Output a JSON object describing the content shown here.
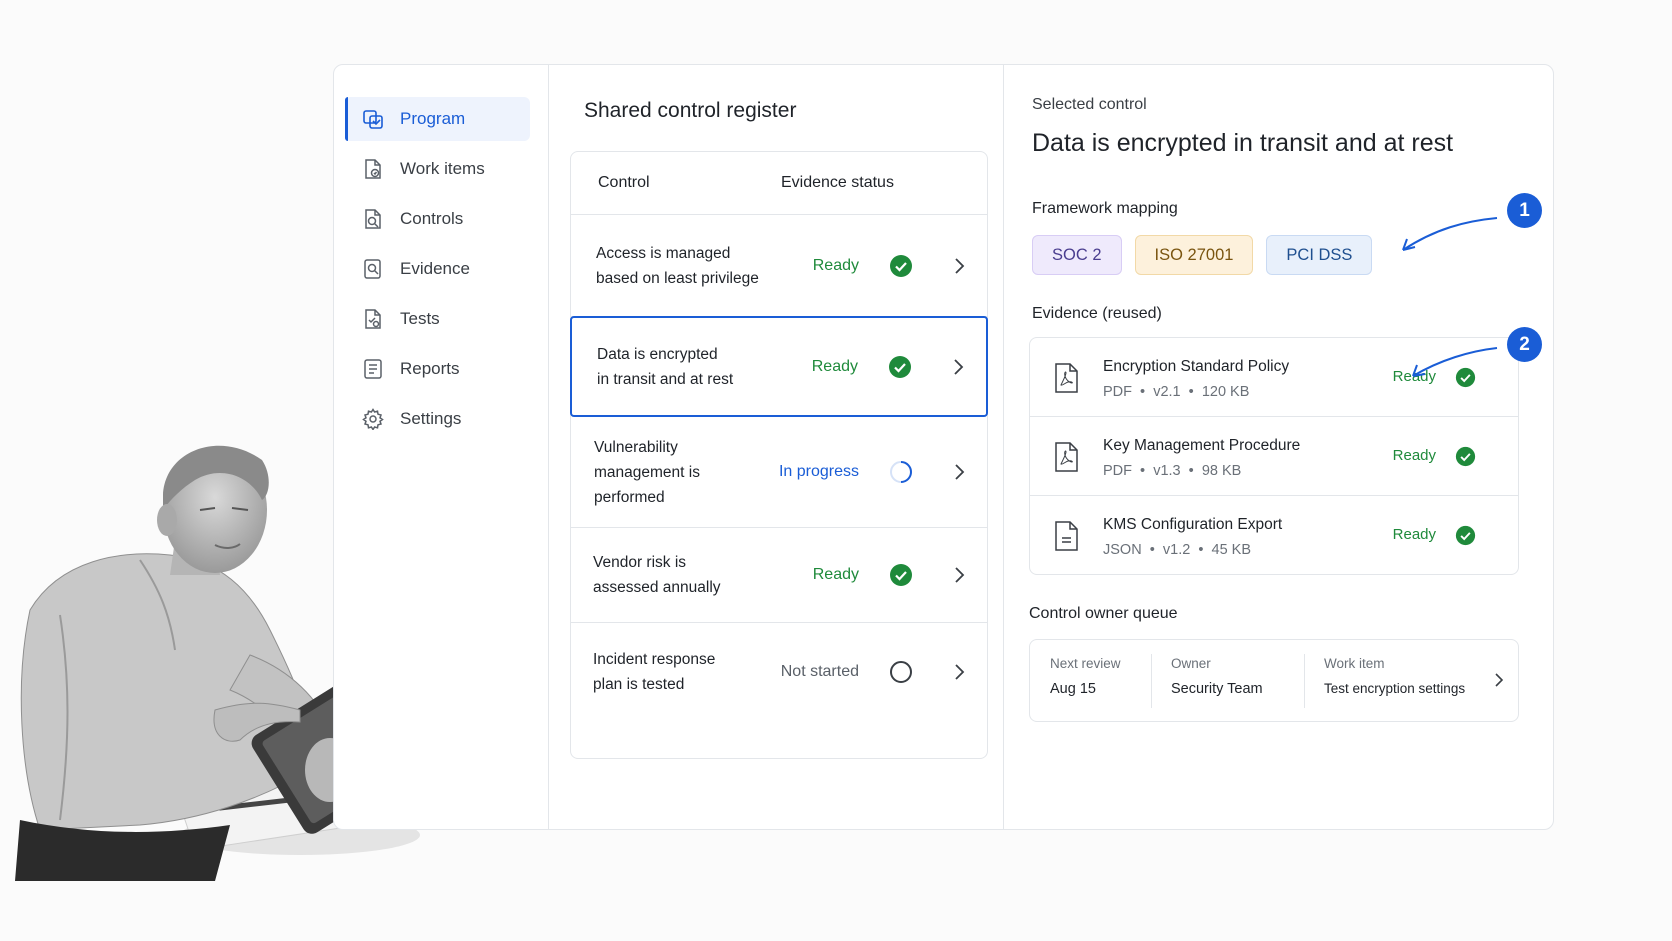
{
  "sidebar": {
    "items": [
      {
        "label": "Program",
        "icon": "program-icon",
        "active": true
      },
      {
        "label": "Work items",
        "icon": "work-items-icon"
      },
      {
        "label": "Controls",
        "icon": "controls-icon"
      },
      {
        "label": "Evidence",
        "icon": "evidence-icon"
      },
      {
        "label": "Tests",
        "icon": "tests-icon"
      },
      {
        "label": "Reports",
        "icon": "reports-icon"
      },
      {
        "label": "Settings",
        "icon": "gear-icon"
      }
    ]
  },
  "register": {
    "title": "Shared control register",
    "columns": {
      "control": "Control",
      "status": "Evidence status"
    },
    "rows": [
      {
        "line1": "Access is managed",
        "line2": "based on least privilege",
        "line3": "",
        "status": "Ready"
      },
      {
        "line1": "Data is encrypted",
        "line2": "in transit and at rest",
        "line3": "",
        "status": "Ready"
      },
      {
        "line1": "Vulnerability",
        "line2": "management is",
        "line3": "performed",
        "status": "In progress"
      },
      {
        "line1": "Vendor risk is",
        "line2": "assessed annually",
        "line3": "",
        "status": "Ready"
      },
      {
        "line1": "Incident response",
        "line2": "plan is tested",
        "line3": "",
        "status": "Not started"
      }
    ]
  },
  "detail": {
    "label": "Selected control",
    "title": "Data is encrypted in transit and at rest",
    "framework_label": "Framework mapping",
    "frameworks": [
      "SOC 2",
      "ISO 27001",
      "PCI DSS"
    ],
    "evidence_label": "Evidence (reused)",
    "evidence": [
      {
        "name": "Encryption Standard Policy",
        "type": "PDF",
        "version": "v2.1",
        "size": "120 KB",
        "status": "Ready"
      },
      {
        "name": "Key Management Procedure",
        "type": "PDF",
        "version": "v1.3",
        "size": "98 KB",
        "status": "Ready"
      },
      {
        "name": "KMS Configuration Export",
        "type": "JSON",
        "version": "v1.2",
        "size": "45 KB",
        "status": "Ready"
      }
    ],
    "queue_label": "Control owner queue",
    "queue": {
      "next_review_label": "Next review",
      "next_review": "Aug 15",
      "owner_label": "Owner",
      "owner": "Security Team",
      "work_item_label": "Work item",
      "work_item": "Test encryption settings"
    }
  },
  "annotations": [
    "1",
    "2"
  ],
  "colors": {
    "accent": "#1a5dd6",
    "ready": "#1f8a3b",
    "border": "#e3e6ea"
  }
}
